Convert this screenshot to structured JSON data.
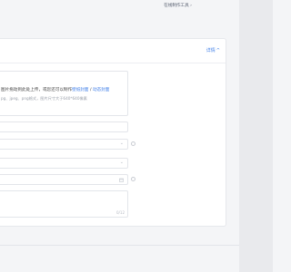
{
  "header": {
    "top_link": "在线制作工具 ›"
  },
  "card": {
    "details_label": "详情",
    "details_chevron": "^"
  },
  "upload": {
    "line1_prefix": "图片拖动到此处上传，或您还可以制作",
    "link1": "壁纸封面",
    "sep": " / ",
    "link2": "动态封面",
    "line2": "pg、jpeg、png格式，图片尺寸大于640*640像素"
  },
  "fields": {
    "field1_value": "",
    "field2_icon": "chevron-down-icon",
    "field3_icon": "chevron-down-icon",
    "field4_icon": "calendar-icon"
  },
  "textarea": {
    "counter": "0/12"
  }
}
